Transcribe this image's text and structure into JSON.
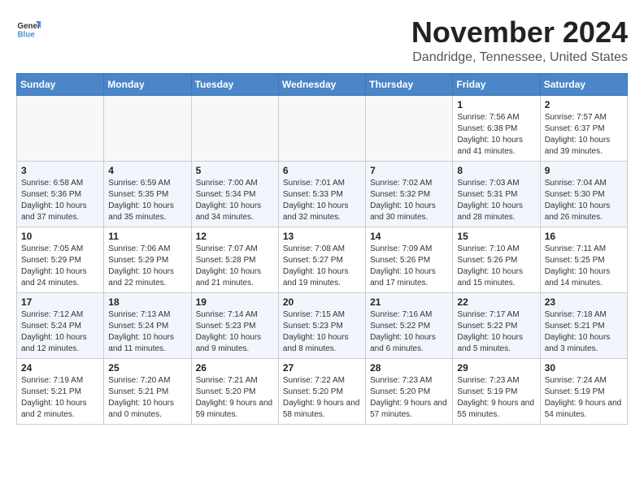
{
  "logo": {
    "general": "General",
    "blue": "Blue"
  },
  "title": "November 2024",
  "location": "Dandridge, Tennessee, United States",
  "headers": [
    "Sunday",
    "Monday",
    "Tuesday",
    "Wednesday",
    "Thursday",
    "Friday",
    "Saturday"
  ],
  "weeks": [
    [
      {
        "day": "",
        "detail": ""
      },
      {
        "day": "",
        "detail": ""
      },
      {
        "day": "",
        "detail": ""
      },
      {
        "day": "",
        "detail": ""
      },
      {
        "day": "",
        "detail": ""
      },
      {
        "day": "1",
        "detail": "Sunrise: 7:56 AM\nSunset: 6:38 PM\nDaylight: 10 hours and 41 minutes."
      },
      {
        "day": "2",
        "detail": "Sunrise: 7:57 AM\nSunset: 6:37 PM\nDaylight: 10 hours and 39 minutes."
      }
    ],
    [
      {
        "day": "3",
        "detail": "Sunrise: 6:58 AM\nSunset: 5:36 PM\nDaylight: 10 hours and 37 minutes."
      },
      {
        "day": "4",
        "detail": "Sunrise: 6:59 AM\nSunset: 5:35 PM\nDaylight: 10 hours and 35 minutes."
      },
      {
        "day": "5",
        "detail": "Sunrise: 7:00 AM\nSunset: 5:34 PM\nDaylight: 10 hours and 34 minutes."
      },
      {
        "day": "6",
        "detail": "Sunrise: 7:01 AM\nSunset: 5:33 PM\nDaylight: 10 hours and 32 minutes."
      },
      {
        "day": "7",
        "detail": "Sunrise: 7:02 AM\nSunset: 5:32 PM\nDaylight: 10 hours and 30 minutes."
      },
      {
        "day": "8",
        "detail": "Sunrise: 7:03 AM\nSunset: 5:31 PM\nDaylight: 10 hours and 28 minutes."
      },
      {
        "day": "9",
        "detail": "Sunrise: 7:04 AM\nSunset: 5:30 PM\nDaylight: 10 hours and 26 minutes."
      }
    ],
    [
      {
        "day": "10",
        "detail": "Sunrise: 7:05 AM\nSunset: 5:29 PM\nDaylight: 10 hours and 24 minutes."
      },
      {
        "day": "11",
        "detail": "Sunrise: 7:06 AM\nSunset: 5:29 PM\nDaylight: 10 hours and 22 minutes."
      },
      {
        "day": "12",
        "detail": "Sunrise: 7:07 AM\nSunset: 5:28 PM\nDaylight: 10 hours and 21 minutes."
      },
      {
        "day": "13",
        "detail": "Sunrise: 7:08 AM\nSunset: 5:27 PM\nDaylight: 10 hours and 19 minutes."
      },
      {
        "day": "14",
        "detail": "Sunrise: 7:09 AM\nSunset: 5:26 PM\nDaylight: 10 hours and 17 minutes."
      },
      {
        "day": "15",
        "detail": "Sunrise: 7:10 AM\nSunset: 5:26 PM\nDaylight: 10 hours and 15 minutes."
      },
      {
        "day": "16",
        "detail": "Sunrise: 7:11 AM\nSunset: 5:25 PM\nDaylight: 10 hours and 14 minutes."
      }
    ],
    [
      {
        "day": "17",
        "detail": "Sunrise: 7:12 AM\nSunset: 5:24 PM\nDaylight: 10 hours and 12 minutes."
      },
      {
        "day": "18",
        "detail": "Sunrise: 7:13 AM\nSunset: 5:24 PM\nDaylight: 10 hours and 11 minutes."
      },
      {
        "day": "19",
        "detail": "Sunrise: 7:14 AM\nSunset: 5:23 PM\nDaylight: 10 hours and 9 minutes."
      },
      {
        "day": "20",
        "detail": "Sunrise: 7:15 AM\nSunset: 5:23 PM\nDaylight: 10 hours and 8 minutes."
      },
      {
        "day": "21",
        "detail": "Sunrise: 7:16 AM\nSunset: 5:22 PM\nDaylight: 10 hours and 6 minutes."
      },
      {
        "day": "22",
        "detail": "Sunrise: 7:17 AM\nSunset: 5:22 PM\nDaylight: 10 hours and 5 minutes."
      },
      {
        "day": "23",
        "detail": "Sunrise: 7:18 AM\nSunset: 5:21 PM\nDaylight: 10 hours and 3 minutes."
      }
    ],
    [
      {
        "day": "24",
        "detail": "Sunrise: 7:19 AM\nSunset: 5:21 PM\nDaylight: 10 hours and 2 minutes."
      },
      {
        "day": "25",
        "detail": "Sunrise: 7:20 AM\nSunset: 5:21 PM\nDaylight: 10 hours and 0 minutes."
      },
      {
        "day": "26",
        "detail": "Sunrise: 7:21 AM\nSunset: 5:20 PM\nDaylight: 9 hours and 59 minutes."
      },
      {
        "day": "27",
        "detail": "Sunrise: 7:22 AM\nSunset: 5:20 PM\nDaylight: 9 hours and 58 minutes."
      },
      {
        "day": "28",
        "detail": "Sunrise: 7:23 AM\nSunset: 5:20 PM\nDaylight: 9 hours and 57 minutes."
      },
      {
        "day": "29",
        "detail": "Sunrise: 7:23 AM\nSunset: 5:19 PM\nDaylight: 9 hours and 55 minutes."
      },
      {
        "day": "30",
        "detail": "Sunrise: 7:24 AM\nSunset: 5:19 PM\nDaylight: 9 hours and 54 minutes."
      }
    ]
  ]
}
